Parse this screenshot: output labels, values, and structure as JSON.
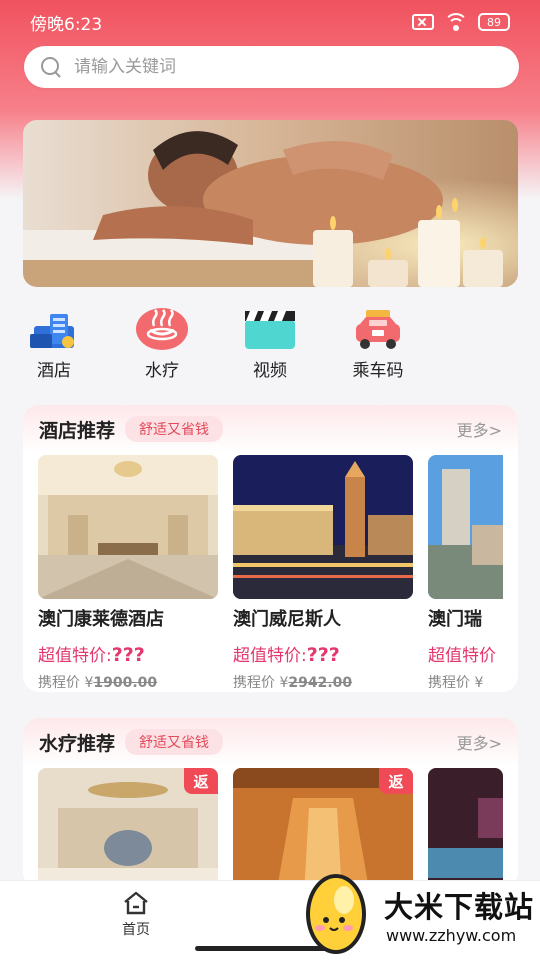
{
  "status_bar": {
    "time": "傍晚6:23",
    "battery": "89",
    "icons": [
      "sim-off-icon",
      "wifi-icon",
      "battery-icon"
    ]
  },
  "search": {
    "placeholder": "请输入关键词"
  },
  "banner": {
    "image": "massage-spa-banner"
  },
  "quick_nav": [
    {
      "label": "酒店",
      "icon": "hotel-icon"
    },
    {
      "label": "水疗",
      "icon": "spa-icon"
    },
    {
      "label": "视频",
      "icon": "video-clapper-icon"
    },
    {
      "label": "乘车码",
      "icon": "car-code-icon"
    }
  ],
  "hotel_section": {
    "title": "酒店推荐",
    "tag": "舒适又省钱",
    "more": "更多>",
    "items": [
      {
        "name": "澳门康莱德酒店",
        "special_label": "超值特价:",
        "special_value": "???",
        "ctrip_label": "携程价 ¥",
        "ctrip_price": "1900.00"
      },
      {
        "name": "澳门威尼斯人",
        "special_label": "超值特价:",
        "special_value": "???",
        "ctrip_label": "携程价 ¥",
        "ctrip_price": "2942.00"
      },
      {
        "name": "澳门瑞",
        "special_label": "超值特价",
        "special_value": "",
        "ctrip_label": "携程价 ¥",
        "ctrip_price": ""
      }
    ]
  },
  "spa_section": {
    "title": "水疗推荐",
    "tag": "舒适又省钱",
    "more": "更多>",
    "badge": "返"
  },
  "bottom_nav": {
    "home_label": "首页"
  },
  "watermark": {
    "title": "大米下载站",
    "url": "www.zzhyw.com"
  },
  "colors": {
    "accent": "#f0525e",
    "price": "#e3376d",
    "badge": "#ef4a55"
  }
}
